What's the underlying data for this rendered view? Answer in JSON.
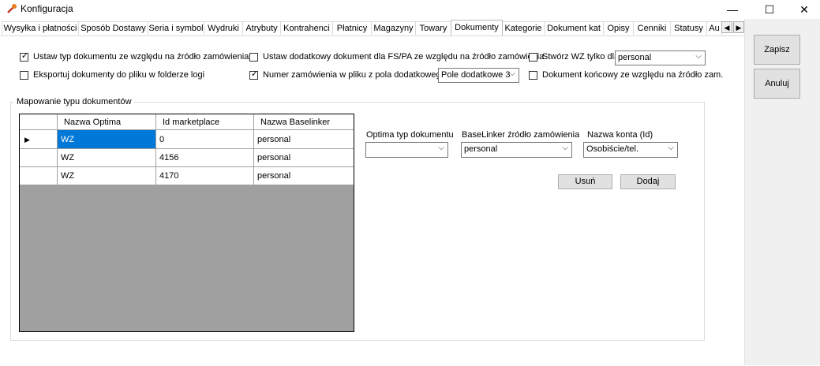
{
  "window": {
    "title": "Konfiguracja",
    "minimize": "—",
    "maximize": "☐",
    "close": "✕"
  },
  "tabs": [
    {
      "label": "Wysyłka i płatności"
    },
    {
      "label": "Sposób Dostawy"
    },
    {
      "label": "Seria i symbol"
    },
    {
      "label": "Wydruki"
    },
    {
      "label": "Atrybuty"
    },
    {
      "label": "Kontrahenci"
    },
    {
      "label": "Płatnicy"
    },
    {
      "label": "Magazyny"
    },
    {
      "label": "Towary"
    },
    {
      "label": "Dokumenty"
    },
    {
      "label": "Kategorie"
    },
    {
      "label": "Dokument kat"
    },
    {
      "label": "Opisy"
    },
    {
      "label": "Cenniki"
    },
    {
      "label": "Statusy"
    },
    {
      "label": "Au"
    }
  ],
  "tab_arrows": {
    "left": "◀",
    "right": "▶"
  },
  "options": {
    "set_doc_type": {
      "label": "Ustaw typ dokumentu ze względu na źródło zamówienia",
      "checked": true,
      "mark": "✓"
    },
    "export_docs": {
      "label": "Eksportuj dokumenty do pliku w folderze logi",
      "checked": false,
      "mark": ""
    },
    "additional_doc": {
      "label": "Ustaw dodatkowy dokument dla FS/PA ze względu na źródło zamówienia",
      "checked": false,
      "mark": ""
    },
    "order_number": {
      "label": "Numer zamówienia w pliku z pola dodatkowego",
      "checked": true,
      "mark": "✓"
    },
    "create_wz": {
      "label": "Stwórz WZ tylko dla",
      "checked": false,
      "mark": ""
    },
    "final_doc": {
      "label": "Dokument końcowy ze względu na źródło zam.",
      "checked": false,
      "mark": ""
    }
  },
  "combos": {
    "create_wz_value": "personal",
    "extra_field_value": "Pole dodatkowe 3"
  },
  "mapping": {
    "title": "Mapowanie typu dokumentów",
    "columns": [
      "Nazwa Optima",
      "Id marketplace",
      "Nazwa Baselinker"
    ],
    "row_indicator": "▶",
    "rows": [
      [
        "WZ",
        "0",
        "personal"
      ],
      [
        "WZ",
        "4156",
        "personal"
      ],
      [
        "WZ",
        "4170",
        "personal"
      ]
    ],
    "fields": {
      "optima_label": "Optima typ dokumentu",
      "optima_value": "",
      "bl_label": "BaseLinker źródło zamówienia",
      "bl_value": "personal",
      "account_label": "Nazwa konta (Id)",
      "account_value": "Osobiście/tel."
    },
    "delete_button": "Usuń",
    "add_button": "Dodaj"
  },
  "side_buttons": {
    "save": "Zapisz",
    "cancel": "Anuluj"
  },
  "colors": {
    "selection": "#0078d7",
    "grid_background": "#a0a0a0"
  }
}
